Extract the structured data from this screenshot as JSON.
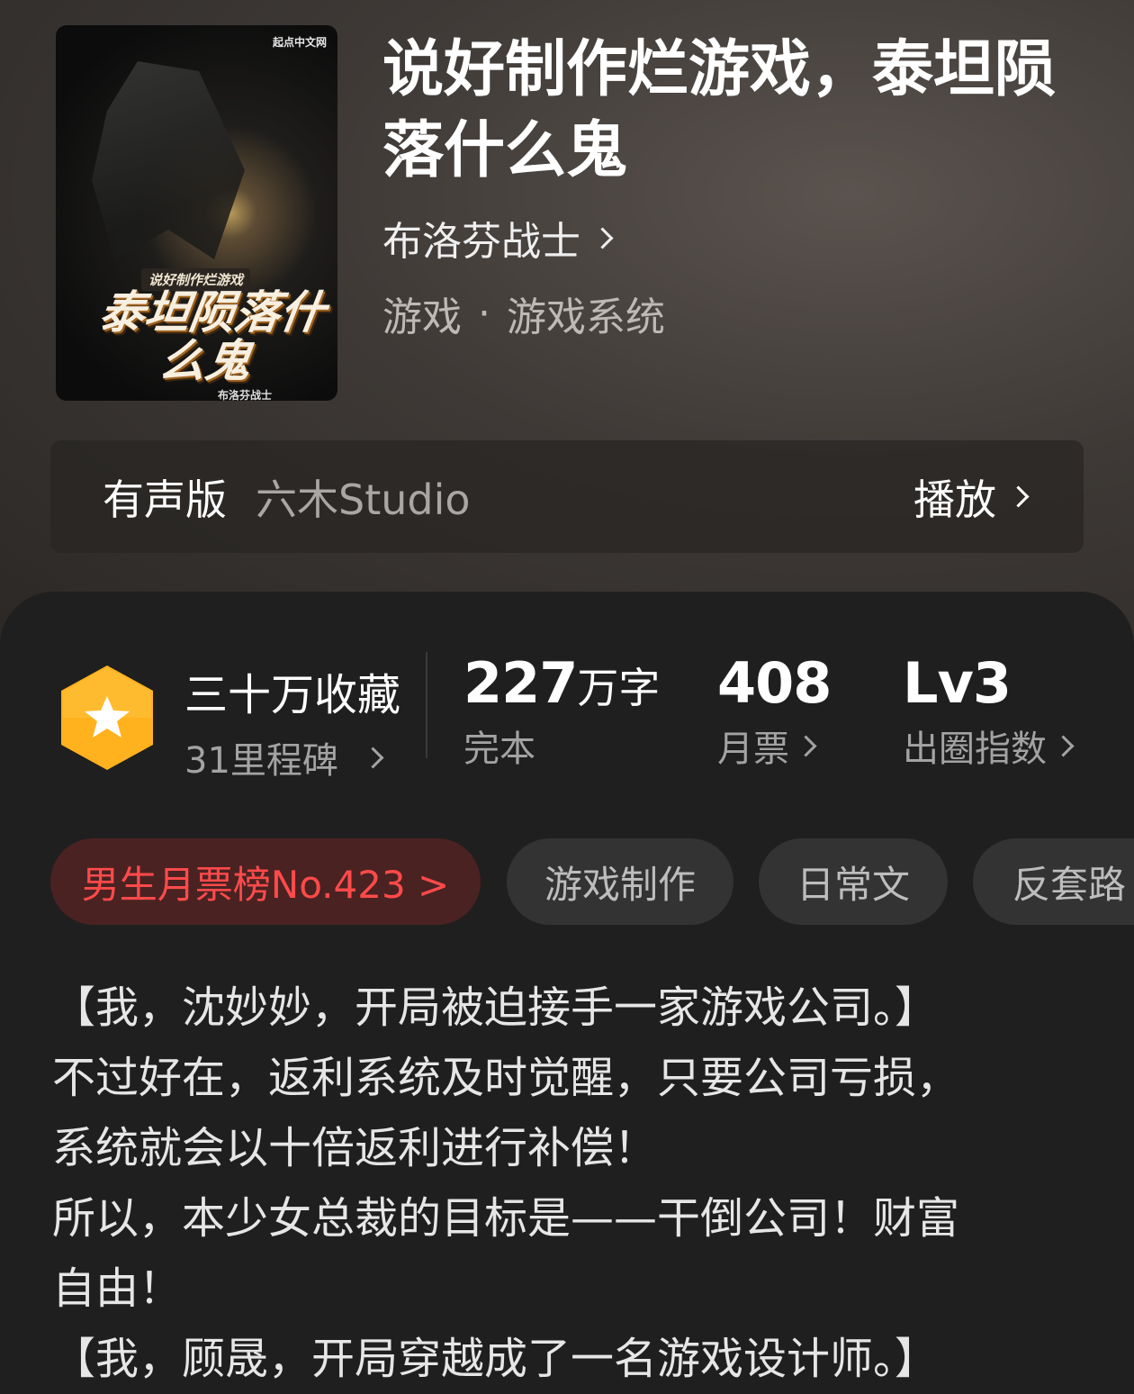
{
  "book": {
    "title": "说好制作烂游戏，泰坦陨落什么鬼",
    "author": "布洛芬战士",
    "genre_primary": "游戏",
    "genre_separator": "·",
    "genre_secondary": "游戏系统"
  },
  "cover": {
    "publisher": "起点中文网",
    "small_title": "说好制作烂游戏",
    "big_title": "泰坦陨落什么鬼",
    "author": "布洛芬战士"
  },
  "audio": {
    "label": "有声版",
    "studio": "六木Studio",
    "play_label": "播放"
  },
  "stats": {
    "collection": "三十万收藏",
    "milestones": "31里程碑",
    "word_count": "227",
    "word_unit": "万字",
    "status": "完本",
    "monthly_votes": "408",
    "monthly_votes_label": "月票",
    "level": "Lv3",
    "level_label": "出圈指数"
  },
  "tags": [
    {
      "label": "男生月票榜No.423 >"
    },
    {
      "label": "游戏制作"
    },
    {
      "label": "日常文"
    },
    {
      "label": "反套路"
    }
  ],
  "synopsis": [
    "【我，沈妙妙，开局被迫接手一家游戏公司。】",
    "不过好在，返利系统及时觉醒，只要公司亏损，",
    "系统就会以十倍返利进行补偿！",
    "所以，本少女总裁的目标是——干倒公司！财富",
    "自由！",
    "【我，顾晟，开局穿越成了一名游戏设计师。】"
  ],
  "colors": {
    "accent_red": "#ff4a4a",
    "badge_orange": "#ffb21e",
    "panel_bg": "#1f1f1f"
  },
  "icons": {
    "badge": "star-hexagon-icon",
    "chevron": "chevron-right-icon"
  }
}
